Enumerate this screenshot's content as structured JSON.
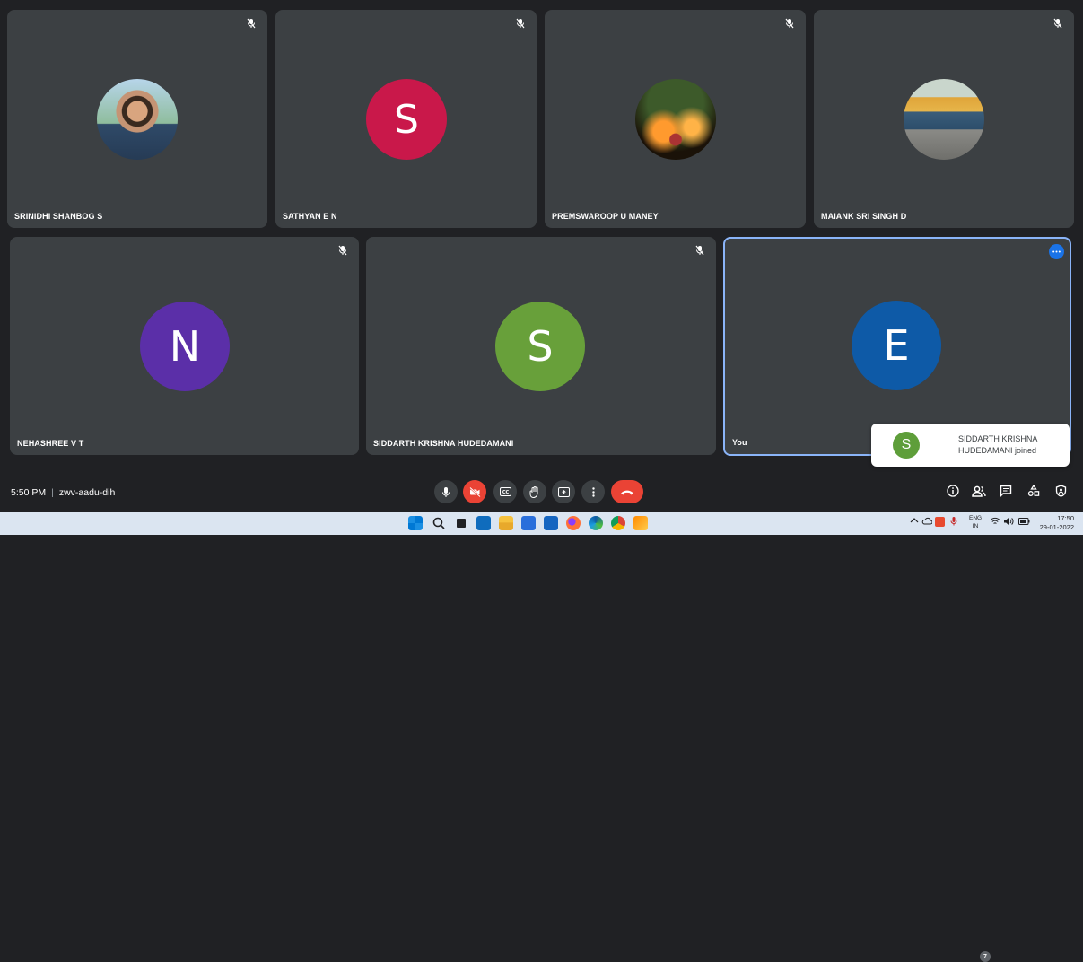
{
  "participants": [
    {
      "name": "SRINIDHI SHANBOG S",
      "avatar_type": "photo",
      "muted": true
    },
    {
      "name": "SATHYAN E N",
      "initial": "S",
      "color": "#c9184a",
      "muted": true
    },
    {
      "name": "PREMSWAROOP U MANEY",
      "avatar_type": "photo",
      "muted": true
    },
    {
      "name": "MAIANK SRI SINGH D",
      "avatar_type": "photo",
      "muted": true
    },
    {
      "name": "NEHASHREE V T",
      "initial": "N",
      "color": "#5b2fa8",
      "muted": true
    },
    {
      "name": "SIDDARTH KRISHNA HUDEDAMANI",
      "initial": "S",
      "color": "#68a03a",
      "muted": true
    },
    {
      "name": "You",
      "initial": "E",
      "color": "#0e5aa7",
      "muted": false
    }
  ],
  "notification": {
    "initial": "S",
    "line1": "SIDDARTH KRISHNA",
    "line2": "HUDEDAMANI joined"
  },
  "meeting": {
    "time": "5:50 PM",
    "separator": "|",
    "code": "zwv-aadu-dih"
  },
  "controls": [
    "mic-icon",
    "camera-off-icon",
    "captions-icon",
    "raise-hand-icon",
    "present-icon",
    "more-options-icon",
    "end-call-icon"
  ],
  "right_controls": [
    "info-icon",
    "people-icon",
    "chat-icon",
    "activities-icon",
    "host-controls-icon"
  ],
  "people_count": "7",
  "taskbar": {
    "lang_top": "ENG",
    "lang_bottom": "IN",
    "time": "17:50",
    "date": "29-01-2022"
  }
}
